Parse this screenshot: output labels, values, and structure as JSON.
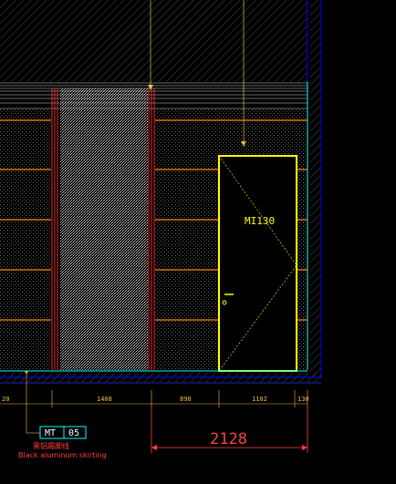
{
  "drawing": {
    "door_tag": "MI130",
    "dimensions": [
      "20",
      "1408",
      "898",
      "1102",
      "130"
    ],
    "total_dimension": "2128",
    "material_tag": {
      "code": "MT",
      "number": "05"
    },
    "note_cn": "黑铝踢脚线",
    "note_en": "Black aluminum skirting"
  },
  "colors": {
    "background": "#000000",
    "wall_border": "#0000ff",
    "wall_edge_cyan": "#00ffff",
    "door": "#ffff00",
    "rails": "#ff8000",
    "panel_red": "#ff3030",
    "dimension": "#e8c040",
    "total_dimension": "#ff4040",
    "hatch": "#606060"
  }
}
